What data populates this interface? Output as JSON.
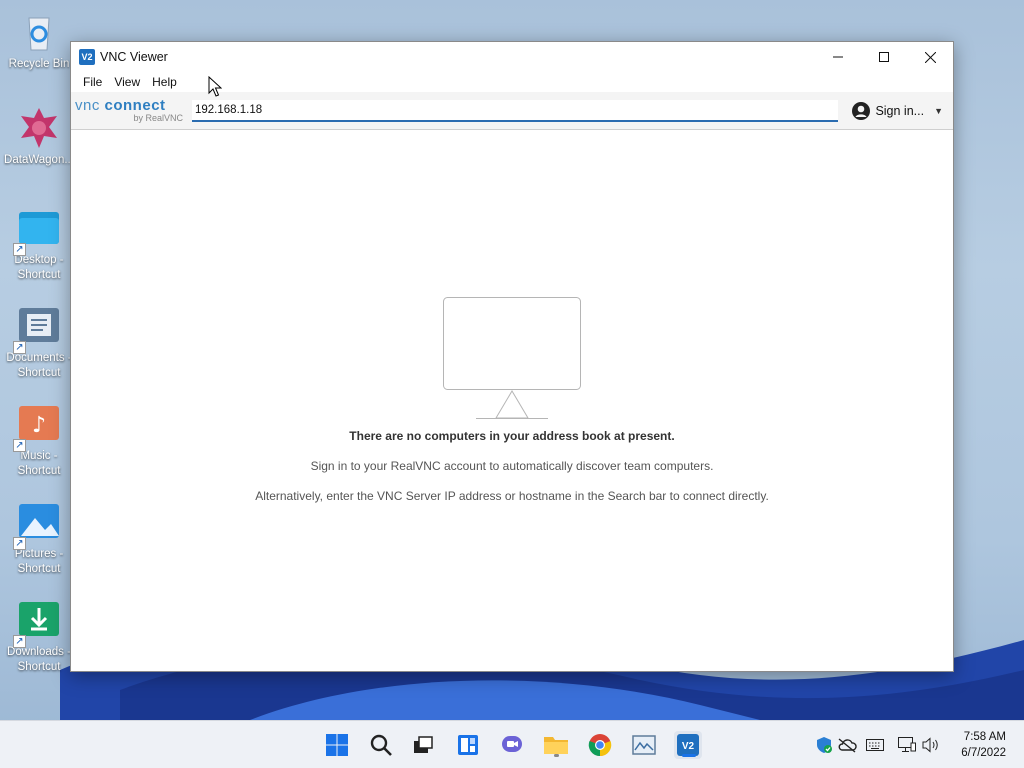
{
  "desktop": {
    "icons": [
      {
        "label": "Recycle Bin",
        "icon": "recycle-bin-icon"
      },
      {
        "label": "DataWagon...",
        "icon": "datawagon-icon"
      },
      {
        "label": "Desktop -\nShortcut",
        "icon": "desktop-folder-icon"
      },
      {
        "label": "Documents -\nShortcut",
        "icon": "documents-folder-icon"
      },
      {
        "label": "Music -\nShortcut",
        "icon": "music-folder-icon"
      },
      {
        "label": "Pictures -\nShortcut",
        "icon": "pictures-folder-icon"
      },
      {
        "label": "Downloads -\nShortcut",
        "icon": "downloads-folder-icon"
      }
    ]
  },
  "window": {
    "title": "VNC Viewer",
    "app_icon_text": "V2",
    "menu": [
      "File",
      "View",
      "Help"
    ],
    "brand": {
      "name_part1": "vnc",
      "name_part2": "connect",
      "tagline": "by RealVNC"
    },
    "search": {
      "value": "192.168.1.18",
      "placeholder": ""
    },
    "signin_label": "Sign in...",
    "empty_state": {
      "heading": "There are no computers in your address book at present.",
      "line1": "Sign in to your RealVNC account to automatically discover team computers.",
      "line2": "Alternatively, enter the VNC Server IP address or hostname in the Search bar to connect directly."
    }
  },
  "taskbar": {
    "apps": [
      "start-icon",
      "search-icon",
      "task-view-icon",
      "widgets-icon",
      "chat-icon",
      "file-explorer-icon",
      "chrome-icon",
      "photos-icon",
      "vnc-viewer-icon"
    ],
    "active_app": "vnc-viewer-icon",
    "tray": [
      "defender-icon",
      "onedrive-icon",
      "keyboard-icon",
      "network-icon",
      "volume-icon"
    ],
    "time": "7:58 AM",
    "date": "6/7/2022"
  },
  "colors": {
    "accent": "#2b6cb0",
    "brand_blue": "#2f7fc1",
    "taskbar_active": "#1a73e8"
  }
}
